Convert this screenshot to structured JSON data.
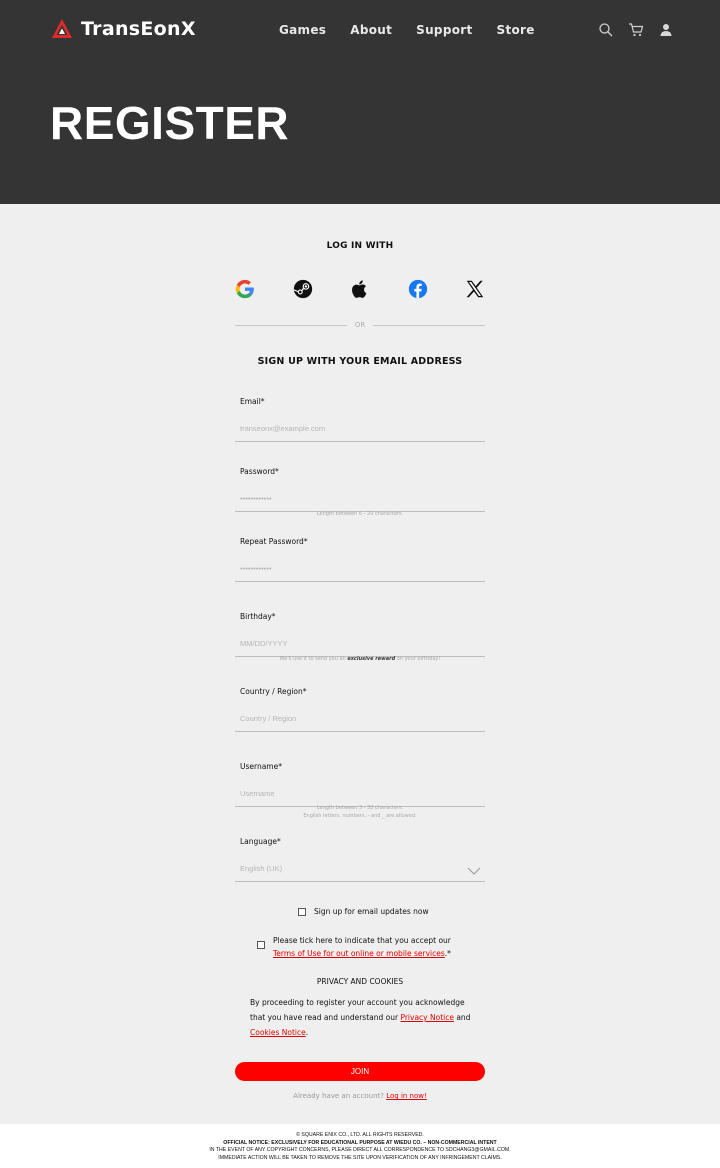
{
  "brand": {
    "name": "TransEonX"
  },
  "nav": {
    "items": [
      "Games",
      "About",
      "Support",
      "Store"
    ]
  },
  "header_icons": [
    "search-icon",
    "cart-icon",
    "user-icon"
  ],
  "page": {
    "title": "REGISTER"
  },
  "login": {
    "heading": "LOG IN WITH",
    "providers": [
      "google-icon",
      "steam-icon",
      "apple-icon",
      "facebook-icon",
      "x-icon"
    ],
    "or": "OR"
  },
  "signup": {
    "heading": "SIGN UP WITH YOUR EMAIL ADDRESS"
  },
  "form": {
    "email": {
      "label": "Email*",
      "placeholder": "transeonx@example.com"
    },
    "password": {
      "label": "Password*",
      "placeholder": "••••••••••••",
      "hint": "Length between 6 - 20 characters."
    },
    "repeat_password": {
      "label": "Repeat Password*",
      "placeholder": "••••••••••••"
    },
    "birthday": {
      "label": "Birthday*",
      "placeholder": "MM/DD/YYYY",
      "hint_before": "We'll use it to send you an ",
      "hint_bold": "exclusive reward",
      "hint_after": " on your birthday!"
    },
    "country": {
      "label": "Country / Region*",
      "placeholder": "Country / Region"
    },
    "username": {
      "label": "Username*",
      "placeholder": "Username",
      "hint_line1": "Length between 3 - 32 characters.",
      "hint_line2": "English letters, numbers, - and _ are allowed."
    },
    "language": {
      "label": "Language*",
      "value": "English (UK)"
    },
    "email_updates": {
      "label": "Sign up for email updates now"
    },
    "terms": {
      "text_before": "Please tick here to indicate that you accept our ",
      "link": "Terms of Use for out online or mobile services",
      "text_after": ".*"
    },
    "privacy": {
      "title": "PRIVACY AND COOKIES",
      "text_before": "By proceeding to register your account you acknowledge that you have read and understand our ",
      "privacy_link": "Privacy Notice",
      "and": " and ",
      "cookies_link": "Cookies Notice",
      "end": "."
    },
    "join_label": "JOIN",
    "already_text": "Already have an account? ",
    "login_link": "Log in now!"
  },
  "footer": {
    "line1": "© SQUARE ENIX CO., LTD. ALL RIGHTS RESERVED.",
    "line2": "OFFICIAL NOTICE: EXCLUSIVELY FOR EDUCATIONAL PURPOSE AT WIEDU CO. – NON-COMMERCIAL INTENT",
    "line3": "IN THE EVENT OF ANY COPYRIGHT CONCERNS, PLEASE DIRECT ALL CORRESPONDENCE TO SDCHANG3@GMAIL.COM.",
    "line4": "IMMEDIATE ACTION WILL BE TAKEN TO REMOVE THE SITE UPON VERIFICATION OF ANY INFRINGEMENT CLAIMS."
  },
  "colors": {
    "header_bg": "#343434",
    "page_bg": "#efefef",
    "accent": "#ff0000"
  }
}
